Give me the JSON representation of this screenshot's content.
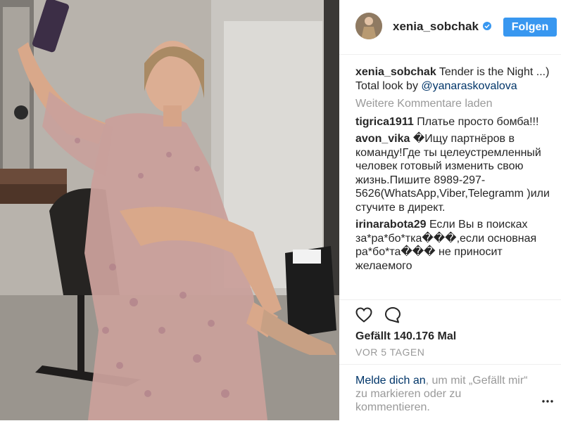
{
  "header": {
    "username": "xenia_sobchak",
    "follow_label": "Folgen"
  },
  "caption": {
    "user": "xenia_sobchak",
    "text": "Tender is the Night ...) Total look by",
    "mention": "@yanaraskovalova"
  },
  "load_more_label": "Weitere Kommentare laden",
  "comments": [
    {
      "user": "tigrica1911",
      "text": "Платье просто бомба!!!"
    },
    {
      "user": "avon_vika",
      "text": "�Ищу партнёров в команду!Где ты целеустремленный человек готовый изменить свою жизнь.Пишите 8989-297-5626(WhatsApp,Viber,Telegramm )или стучите в директ."
    },
    {
      "user": "irinarabota29",
      "text": "Если Вы в поисках за*ра*бо*тка���,если основная ра*бо*та��� не приносит желаемого"
    }
  ],
  "stats": {
    "likes": "Gefällt 140.176 Mal",
    "time": "VOR 5 TAGEN"
  },
  "footer": {
    "login_link": "Melde dich an",
    "login_rest": ", um mit „Gefällt mir“ zu markieren oder zu kommentieren."
  },
  "colors": {
    "accent": "#3897f0",
    "link": "#003569",
    "muted": "#999999",
    "text": "#262626"
  },
  "icons": [
    "verified-badge-icon",
    "heart-icon",
    "comment-bubble-icon",
    "more-options-icon"
  ]
}
